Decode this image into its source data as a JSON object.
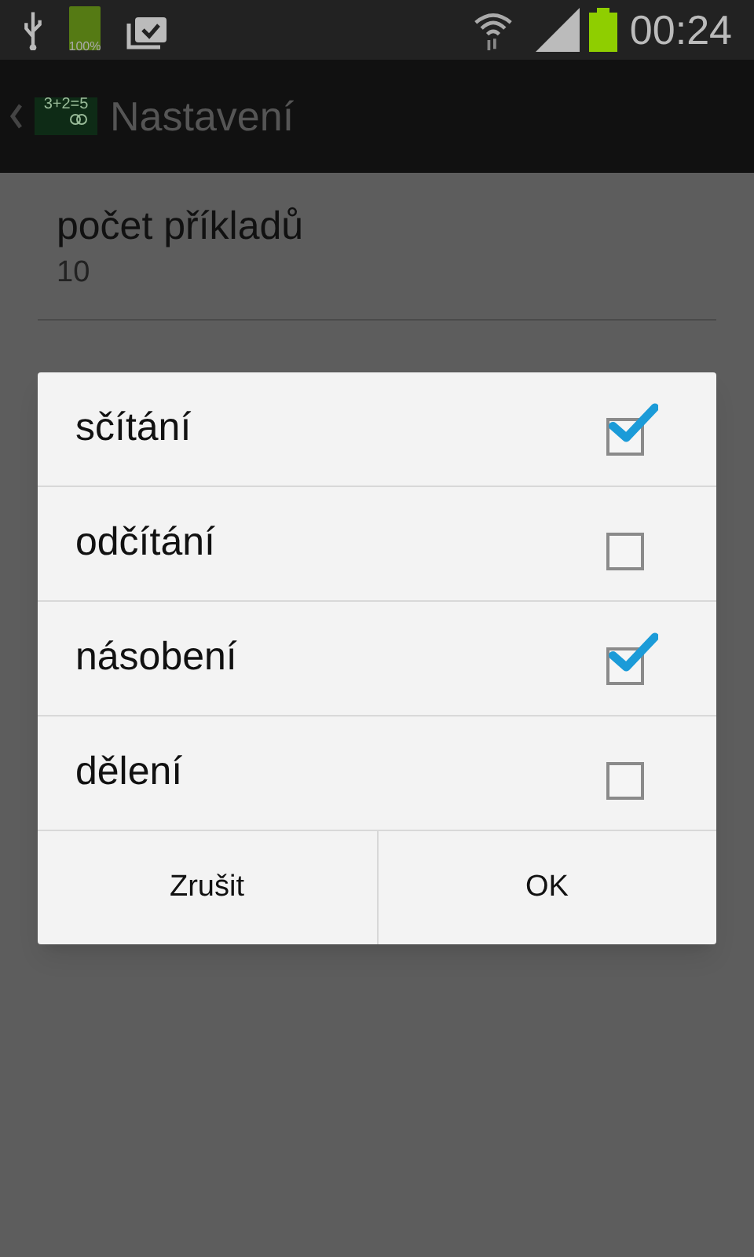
{
  "status_bar": {
    "battery_text": "100%",
    "time": "00:24"
  },
  "action_bar": {
    "logo_text": "3+2=5",
    "title": "Nastavení"
  },
  "preferences": [
    {
      "title": "počet příkladů",
      "summary": "10"
    }
  ],
  "dialog": {
    "options": [
      {
        "label": "sčítání",
        "checked": true
      },
      {
        "label": "odčítání",
        "checked": false
      },
      {
        "label": "násobení",
        "checked": true
      },
      {
        "label": "dělení",
        "checked": false
      }
    ],
    "buttons": [
      "Zrušit",
      "OK"
    ]
  }
}
